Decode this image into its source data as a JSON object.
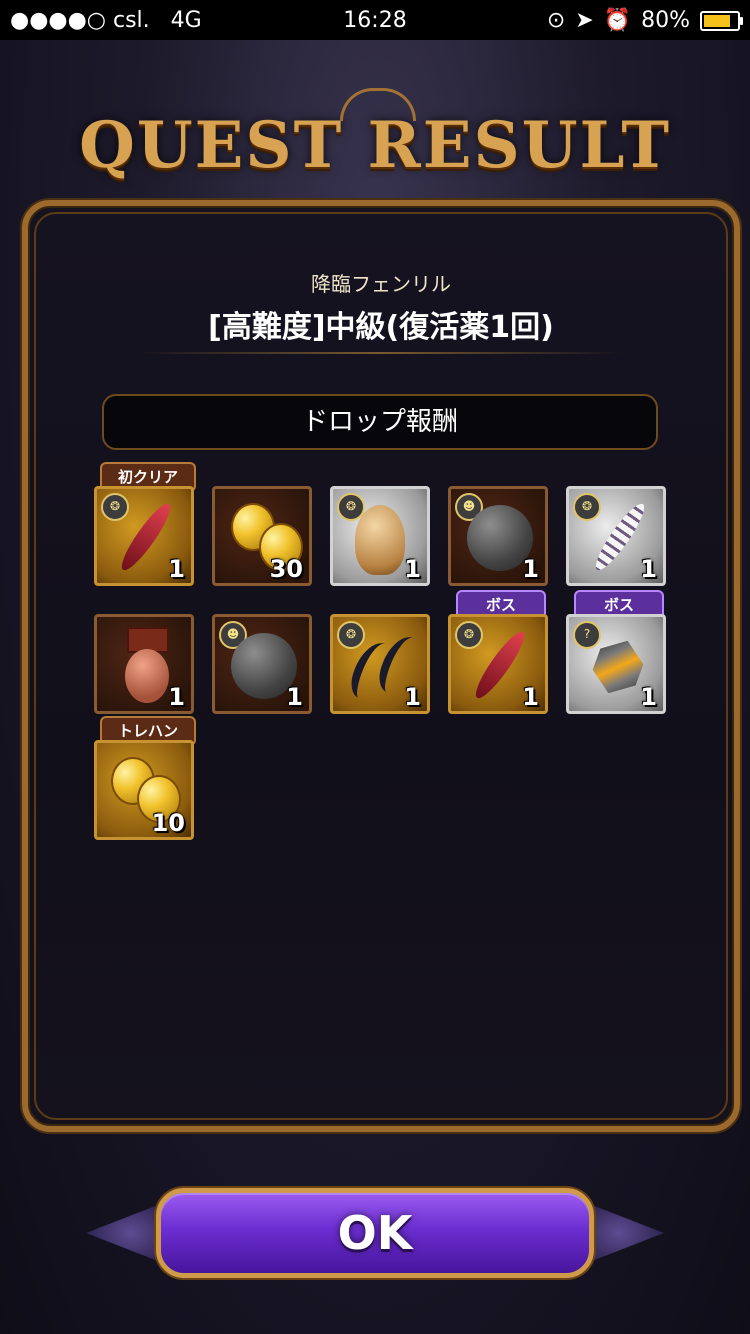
{
  "status_bar": {
    "carrier": "●●●●○ csl.",
    "network": "4G",
    "time": "16:28",
    "battery": "80%",
    "battery_level": 0.8
  },
  "title": "QUEST RESULT",
  "quest": {
    "name": "降臨フェンリル",
    "difficulty": "[高難度]中級(復活薬1回)"
  },
  "drop_header": "ドロップ報酬",
  "rewards": [
    {
      "icon": "red-feather-icon",
      "qty": "1",
      "frame": "gold",
      "tag": "初クリア"
    },
    {
      "icon": "gold-coins-icon",
      "qty": "30",
      "frame": "bronze",
      "tag": ""
    },
    {
      "icon": "beige-fur-icon",
      "qty": "1",
      "frame": "silver",
      "tag": ""
    },
    {
      "icon": "dark-orb-icon",
      "qty": "1",
      "frame": "bronze",
      "tag": ""
    },
    {
      "icon": "white-feather-icon",
      "qty": "1",
      "frame": "silver",
      "tag": ""
    },
    {
      "icon": "top-hat-rabbit-icon",
      "qty": "1",
      "frame": "bronze",
      "tag": ""
    },
    {
      "icon": "dark-orb-icon",
      "qty": "1",
      "frame": "bronze",
      "tag": ""
    },
    {
      "icon": "black-claws-icon",
      "qty": "1",
      "frame": "gold",
      "tag": ""
    },
    {
      "icon": "red-feather-icon",
      "qty": "1",
      "frame": "gold",
      "tag": "ボス"
    },
    {
      "icon": "amber-crystal-icon",
      "qty": "1",
      "frame": "silver",
      "tag": "ボス"
    },
    {
      "icon": "gold-coins-icon",
      "qty": "10",
      "frame": "gold",
      "tag": "トレハン"
    }
  ],
  "ok_button": "OK",
  "colors": {
    "gold_frame": "#c79232",
    "panel_border": "#9c6a2d",
    "ok_purple": "#6b2ed1"
  }
}
